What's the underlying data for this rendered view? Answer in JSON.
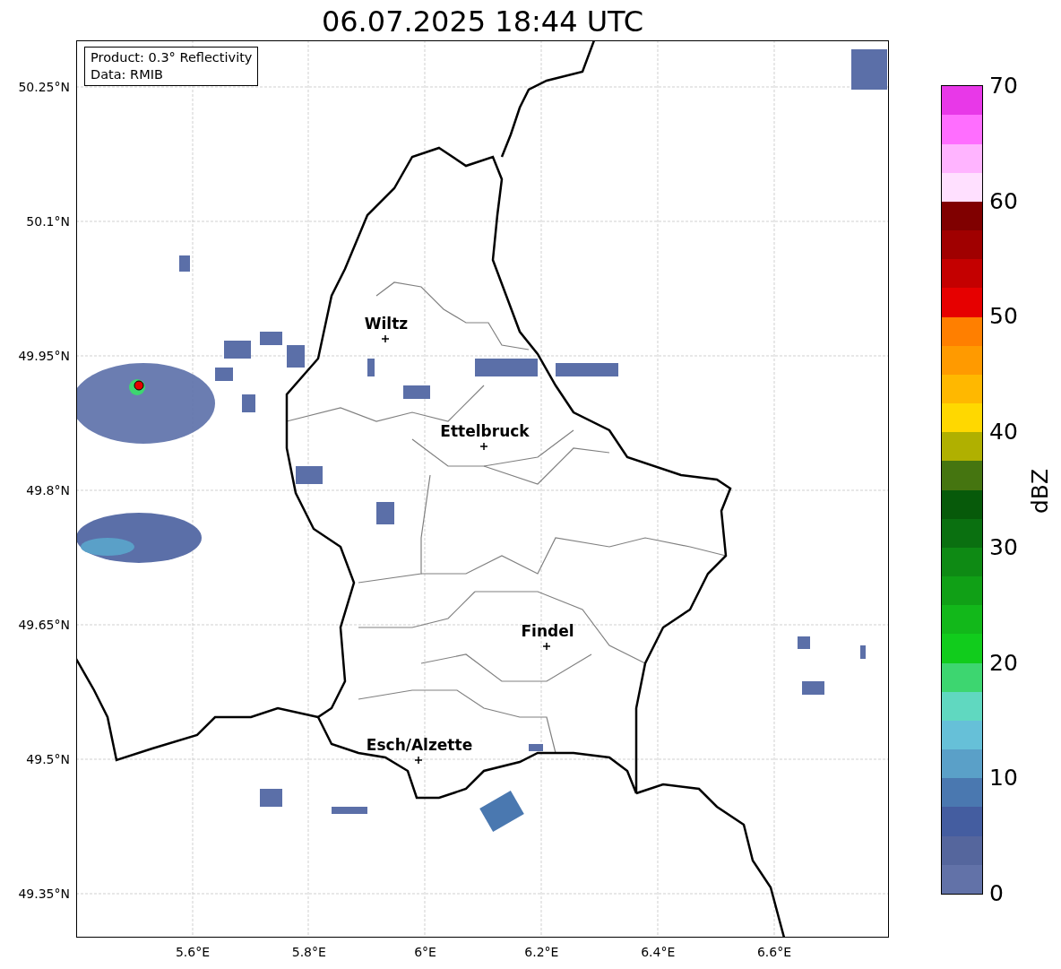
{
  "title": "06.07.2025 18:44 UTC",
  "info_box": [
    "Product: 0.3° Reflectivity",
    "Data: RMIB"
  ],
  "lat_ticks": [
    "50.25°N",
    "50.1°N",
    "49.95°N",
    "49.8°N",
    "49.65°N",
    "49.5°N",
    "49.35°N"
  ],
  "lon_ticks": [
    "5.6°E",
    "5.8°E",
    "6°E",
    "6.2°E",
    "6.4°E",
    "6.6°E"
  ],
  "cities": [
    {
      "name": "Wiltz"
    },
    {
      "name": "Ettelbruck"
    },
    {
      "name": "Findel"
    },
    {
      "name": "Esch/Alzette"
    }
  ],
  "colorbar": {
    "label": "dBZ",
    "ticks": [
      "70",
      "60",
      "50",
      "40",
      "30",
      "20",
      "10",
      "0"
    ],
    "segments": [
      {
        "color": "#6272a8"
      },
      {
        "color": "#55669d"
      },
      {
        "color": "#445da0"
      },
      {
        "color": "#4a78b0"
      },
      {
        "color": "#5aa0c8"
      },
      {
        "color": "#66c0d8"
      },
      {
        "color": "#60d8c0"
      },
      {
        "color": "#3dd670"
      },
      {
        "color": "#11cc1c"
      },
      {
        "color": "#12b81a"
      },
      {
        "color": "#10a016"
      },
      {
        "color": "#0e8a14"
      },
      {
        "color": "#0a7010"
      },
      {
        "color": "#075a0a"
      },
      {
        "color": "#457510"
      },
      {
        "color": "#b0b000"
      },
      {
        "color": "#ffd800"
      },
      {
        "color": "#ffb800"
      },
      {
        "color": "#ff9a00"
      },
      {
        "color": "#ff7f00"
      },
      {
        "color": "#e60000"
      },
      {
        "color": "#c40000"
      },
      {
        "color": "#a00000"
      },
      {
        "color": "#800000"
      },
      {
        "color": "#ffe0ff"
      },
      {
        "color": "#ffb4ff"
      },
      {
        "color": "#ff6eff"
      },
      {
        "color": "#e838e8"
      }
    ]
  }
}
